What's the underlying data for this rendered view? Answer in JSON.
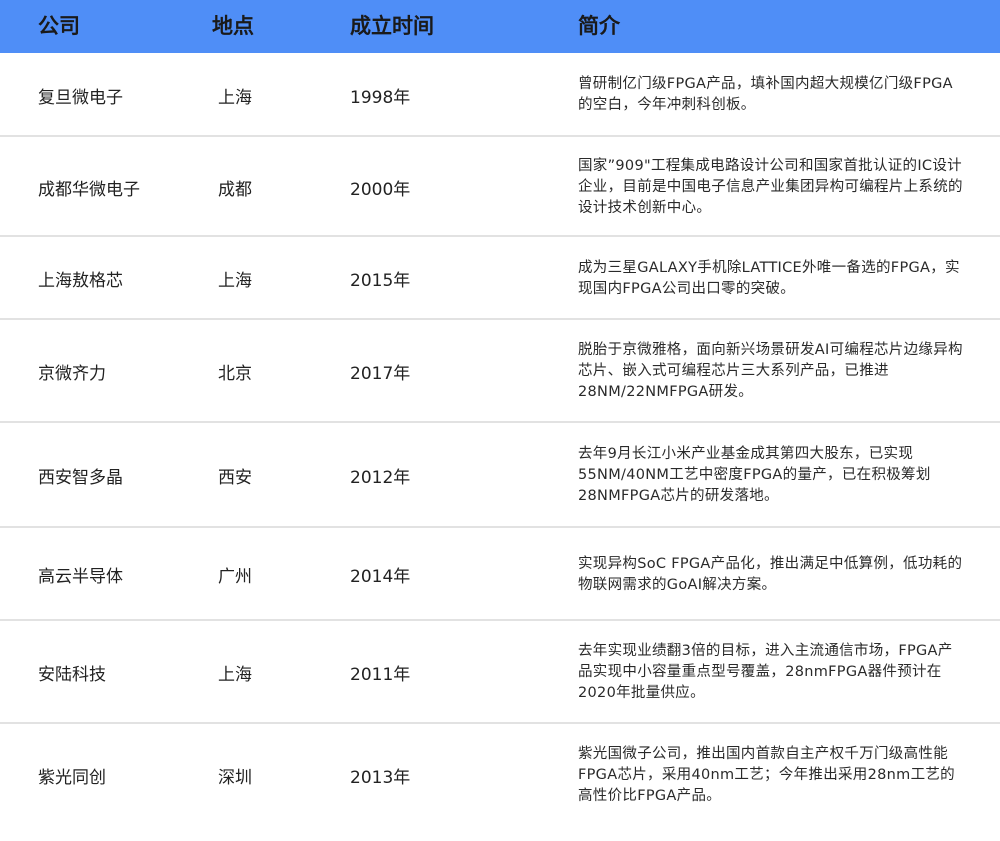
{
  "header": {
    "company": "公司",
    "location": "地点",
    "founded": "成立时间",
    "description": "简介"
  },
  "rows": [
    {
      "company": "复旦微电子",
      "location": "上海",
      "founded": "1998年",
      "description": "曾研制亿门级FPGA产品，填补国内超大规模亿门级FPGA的空白，今年冲刺科创板。"
    },
    {
      "company": "成都华微电子",
      "location": "成都",
      "founded": "2000年",
      "description": "国家”909\"工程集成电路设计公司和国家首批认证的IC设计企业，目前是中国电子信息产业集团异构可编程片上系统的设计技术创新中心。"
    },
    {
      "company": "上海敖格芯",
      "location": "上海",
      "founded": "2015年",
      "description": "成为三星GALAXY手机除LATTICE外唯一备选的FPGA，实现国内FPGA公司出口零的突破。"
    },
    {
      "company": "京微齐力",
      "location": "北京",
      "founded": "2017年",
      "description": "脱胎于京微雅格，面向新兴场景研发AI可编程芯片边缘异构芯片、嵌入式可编程芯片三大系列产品，已推进28NM/22NMFPGA研发。"
    },
    {
      "company": "西安智多晶",
      "location": "西安",
      "founded": "2012年",
      "description": "去年9月长江小米产业基金成其第四大股东，已实现55NM/40NM工艺中密度FPGA的量产，已在积极筹划28NMFPGA芯片的研发落地。"
    },
    {
      "company": "高云半导体",
      "location": "广州",
      "founded": "2014年",
      "description": "实现异构SoC FPGA产品化，推出满足中低算例，低功耗的物联网需求的GoAI解决方案。"
    },
    {
      "company": "安陆科技",
      "location": "上海",
      "founded": "2011年",
      "description": "去年实现业绩翻3倍的目标，进入主流通信市场，FPGA产品实现中小容量重点型号覆盖，28nmFPGA器件预计在2020年批量供应。"
    },
    {
      "company": "紫光同创",
      "location": "深圳",
      "founded": "2013年",
      "description": "紫光国微子公司，推出国内首款自主产权千万门级高性能FPGA芯片，采用40nm工艺；今年推出采用28nm工艺的高性价比FPGA产品。"
    }
  ]
}
